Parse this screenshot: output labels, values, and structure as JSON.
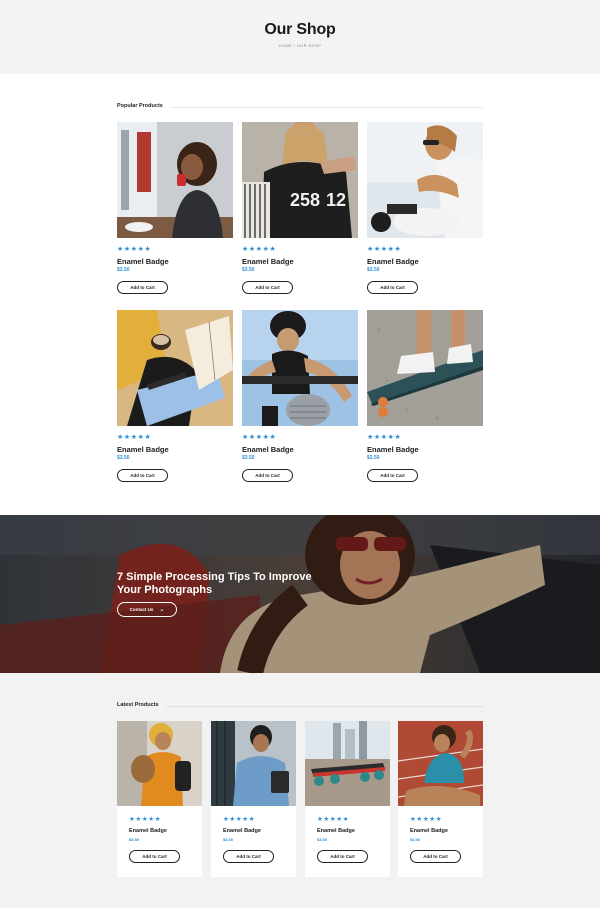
{
  "header": {
    "title": "Our Shop",
    "breadcrumb": "HOME / OUR SHOP"
  },
  "popular": {
    "title": "Popular Products",
    "products": [
      {
        "name": "Enamel Badge",
        "price": "$3.50",
        "rating": "★★★★★",
        "button": "Add to Cart"
      },
      {
        "name": "Enamel Badge",
        "price": "$3.50",
        "rating": "★★★★★",
        "button": "Add to Cart"
      },
      {
        "name": "Enamel Badge",
        "price": "$3.50",
        "rating": "★★★★★",
        "button": "Add to Cart"
      },
      {
        "name": "Enamel Badge",
        "price": "$3.50",
        "rating": "★★★★★",
        "button": "Add to Cart"
      },
      {
        "name": "Enamel Badge",
        "price": "$3.50",
        "rating": "★★★★★",
        "button": "Add to Cart"
      },
      {
        "name": "Enamel Badge",
        "price": "$3.50",
        "rating": "★★★★★",
        "button": "Add to Cart"
      }
    ]
  },
  "banner": {
    "title": "7 Simple Processing Tips To Improve Your Photographs",
    "button": "Contact Us"
  },
  "latest": {
    "title": "Latest Products",
    "products": [
      {
        "name": "Enamel Badge",
        "price": "$3.50",
        "rating": "★★★★★",
        "button": "Add to Cart"
      },
      {
        "name": "Enamel Badge",
        "price": "$3.50",
        "rating": "★★★★★",
        "button": "Add to Cart"
      },
      {
        "name": "Enamel Badge",
        "price": "$3.50",
        "rating": "★★★★★",
        "button": "Add to Cart"
      },
      {
        "name": "Enamel Badge",
        "price": "$3.50",
        "rating": "★★★★★",
        "button": "Add to Cart"
      }
    ]
  },
  "colors": {
    "accent": "#2e8fd6",
    "text": "#1d1d1d",
    "page_bg": "#f3f3f3"
  }
}
